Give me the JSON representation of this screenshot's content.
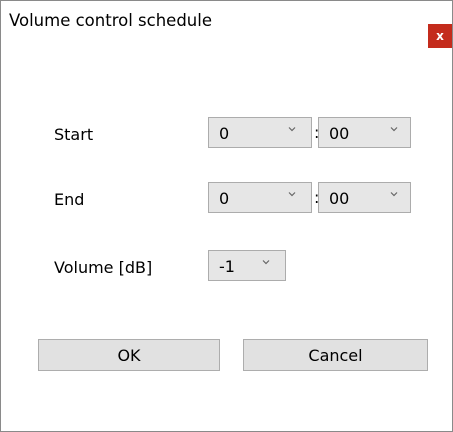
{
  "window": {
    "title": "Volume control schedule",
    "close_label": "x"
  },
  "form": {
    "start_label": "Start",
    "end_label": "End",
    "volume_label": "Volume [dB]",
    "start_hour": "0",
    "start_minute": "00",
    "end_hour": "0",
    "end_minute": "00",
    "volume_value": "-1",
    "separator": ":"
  },
  "buttons": {
    "ok_label": "OK",
    "cancel_label": "Cancel"
  },
  "colors": {
    "close_background": "#c42b1c",
    "combo_background": "#e6e6e6",
    "button_background": "#e1e1e1"
  },
  "icons": {
    "dropdown": "chevron-down-icon",
    "close": "close-icon"
  }
}
